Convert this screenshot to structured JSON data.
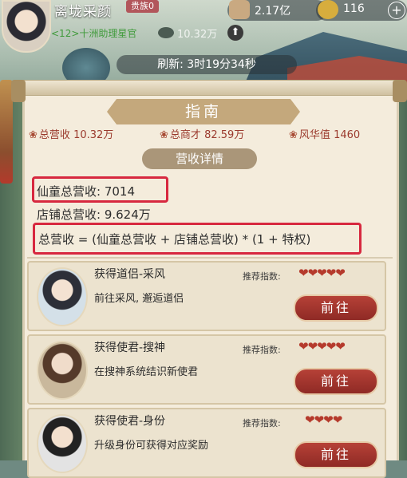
{
  "header": {
    "player_name": "离垅采颜",
    "rank_badge": "贵族0",
    "subtitle": "<12>十洲助理星官",
    "talent_value": "10.32万",
    "currencies": [
      {
        "icon": "scroll-coin-icon",
        "value": "2.17亿"
      },
      {
        "icon": "gold-ingot-icon",
        "value": "116"
      }
    ],
    "refresh": "刷新: 3时19分34秒"
  },
  "panel": {
    "title": "指南",
    "stats": [
      {
        "label": "总营收",
        "value": "10.32万"
      },
      {
        "label": "总商才",
        "value": "82.59万"
      },
      {
        "label": "风华值",
        "value": "1460"
      }
    ],
    "section_title": "营收详情",
    "immortal_revenue": "仙童总营收: 7014",
    "shop_revenue": "店铺总营收: 9.624万",
    "formula": "总营收 = (仙童总营收 + 店铺总营收) * (1 + 特权)"
  },
  "guides": [
    {
      "title": "获得道侣-采风",
      "desc": "前往采风, 邂逅道侣",
      "rec_label": "推荐指数:",
      "hearts": "❤❤❤❤❤",
      "button": "前往"
    },
    {
      "title": "获得使君-搜神",
      "desc": "在搜神系统结识新使君",
      "rec_label": "推荐指数:",
      "hearts": "❤❤❤❤❤",
      "button": "前往"
    },
    {
      "title": "获得使君-身份",
      "desc": "升级身份可获得对应奖励",
      "rec_label": "推荐指数:",
      "hearts": "❤❤❤❤",
      "button": "前往"
    }
  ],
  "colors": {
    "accent_red": "#b64137",
    "highlight_box": "#d7283f",
    "banner": "#c4a87c"
  }
}
